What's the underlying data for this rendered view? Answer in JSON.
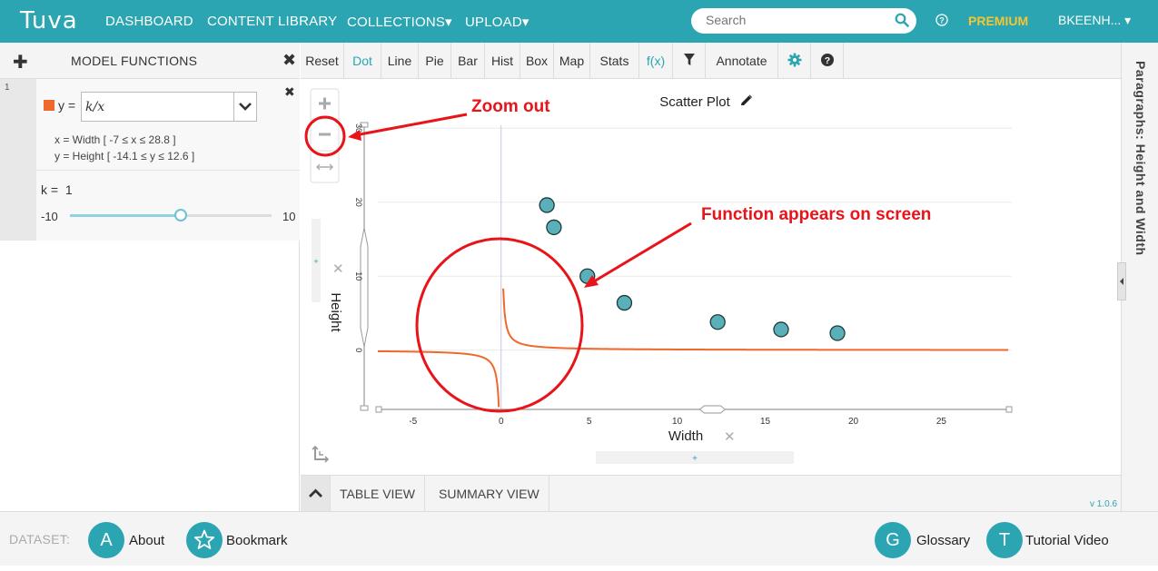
{
  "app": {
    "logo_text": "Tuva",
    "nav": [
      "DASHBOARD",
      "CONTENT LIBRARY",
      "COLLECTIONS▾",
      "UPLOAD▾"
    ],
    "search_placeholder": "Search",
    "premium": "PREMIUM",
    "user": "BKEENH... ▾",
    "brand_color": "#2aa5b1",
    "premium_color": "#f3c634"
  },
  "left_panel": {
    "title": "MODEL FUNCTIONS",
    "function": {
      "index": "1",
      "y_label": "y =",
      "expression": "k/x",
      "x_range": "x = Width  [ -7 ≤ x ≤ 28.8 ]",
      "y_range": "y = Height [ -14.1 ≤ y ≤ 12.6 ]",
      "color": "#f0692c"
    },
    "slider": {
      "label": "k =",
      "value": "1",
      "min": "-10",
      "max": "10",
      "fraction": 0.55
    }
  },
  "toolbar": {
    "buttons": [
      "Reset",
      "Dot",
      "Line",
      "Pie",
      "Bar",
      "Hist",
      "Box",
      "Map",
      "Stats",
      "f(x)"
    ],
    "active": "Dot",
    "annotate": "Annotate",
    "icons": [
      "filter-icon",
      "gear-icon",
      "help-icon"
    ]
  },
  "right_sidebar": {
    "title": "Paragraphs: Height and Width"
  },
  "graph": {
    "title": "Scatter Plot",
    "xlabel": "Width",
    "ylabel": "Height",
    "zoom_icons": [
      "zoom-in-icon",
      "zoom-out-icon",
      "fit-width-icon"
    ]
  },
  "chart_data": {
    "type": "scatter",
    "title": "Scatter Plot",
    "xlabel": "Width",
    "ylabel": "Height",
    "xlim": [
      -7,
      29
    ],
    "ylim": [
      -8,
      31
    ],
    "x_ticks": [
      -5,
      0,
      5,
      10,
      15,
      20,
      25
    ],
    "y_ticks": [
      0,
      10,
      20,
      30
    ],
    "points": [
      {
        "x": 2.6,
        "y": 19.6
      },
      {
        "x": 3.0,
        "y": 16.6
      },
      {
        "x": 4.9,
        "y": 10.0
      },
      {
        "x": 7.0,
        "y": 6.4
      },
      {
        "x": 12.3,
        "y": 3.8
      },
      {
        "x": 15.9,
        "y": 2.8
      },
      {
        "x": 19.1,
        "y": 2.3
      }
    ],
    "point_color": "#5ab0b8",
    "function": {
      "expression": "k/x",
      "k": 1,
      "color": "#f0692c"
    },
    "annotations": [
      {
        "text": "Zoom out",
        "color": "#e8141a"
      },
      {
        "text": "Function appears on screen",
        "color": "#e8141a"
      }
    ]
  },
  "bottom_tabs": {
    "tabs": [
      "TABLE VIEW",
      "SUMMARY VIEW"
    ],
    "version": "v 1.0.6"
  },
  "footer": {
    "dataset_label": "DATASET:",
    "items": [
      {
        "letter": "A",
        "label": "About"
      },
      {
        "label": "Bookmark"
      },
      {
        "letter": "G",
        "label": "Glossary"
      },
      {
        "letter": "T",
        "label": "Tutorial Video"
      }
    ]
  }
}
